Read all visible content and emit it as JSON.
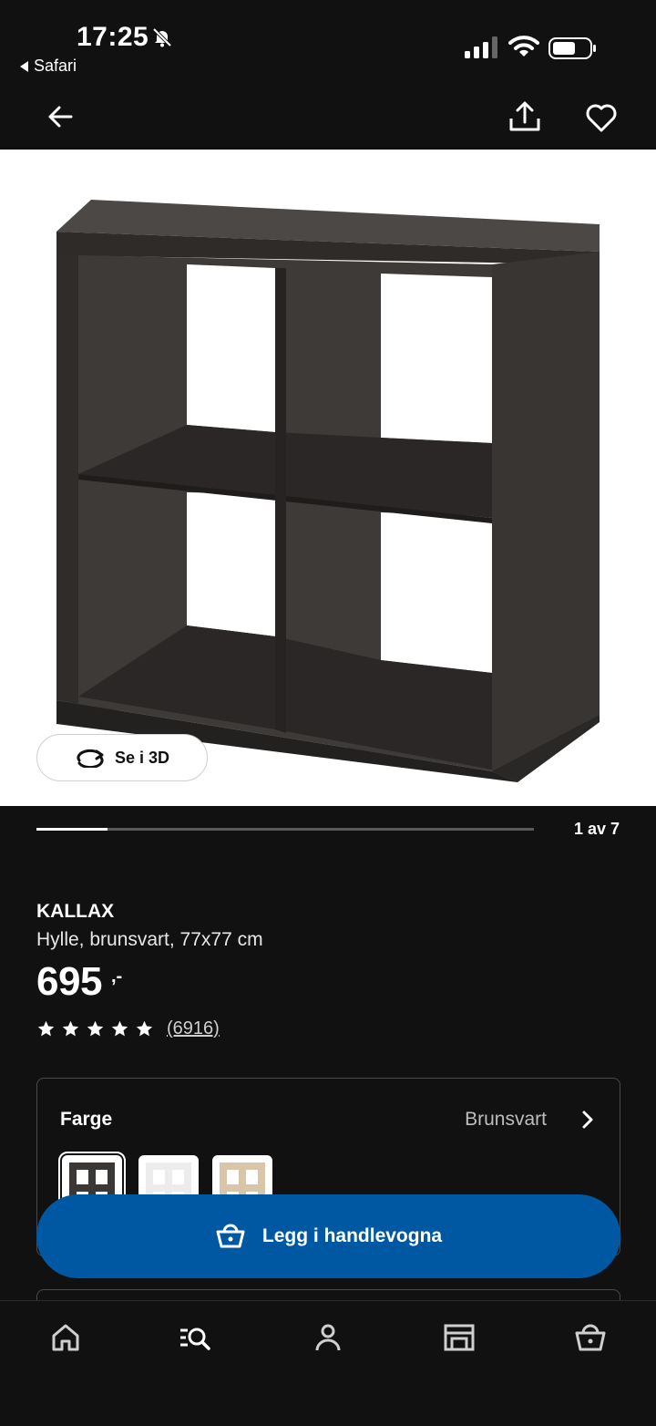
{
  "status_bar": {
    "time": "17:25",
    "back_app": "Safari"
  },
  "navbar": {
    "back_icon": "arrow-left-icon",
    "share_icon": "share-icon",
    "favorite_icon": "heart-icon"
  },
  "gallery": {
    "see_3d_label": "Se i 3D",
    "counter": "1 av 7",
    "current": 1,
    "total": 7
  },
  "product": {
    "name": "KALLAX",
    "description": "Hylle, brunsvart, 77x77 cm",
    "price": "695",
    "price_suffix": ",-",
    "rating_stars": 5,
    "review_count": "(6916)"
  },
  "color_option": {
    "label": "Farge",
    "selected_value": "Brunsvart",
    "swatches": [
      "brunsvart",
      "hvit",
      "eikemønstret"
    ]
  },
  "cart_button": {
    "label": "Legg i handlevogna"
  },
  "tabbar": {
    "items": [
      "home-icon",
      "search-icon",
      "profile-icon",
      "store-icon",
      "cart-icon"
    ]
  },
  "colors": {
    "accent": "#0058a3",
    "background": "#111111",
    "shelf": "#3a3735"
  }
}
